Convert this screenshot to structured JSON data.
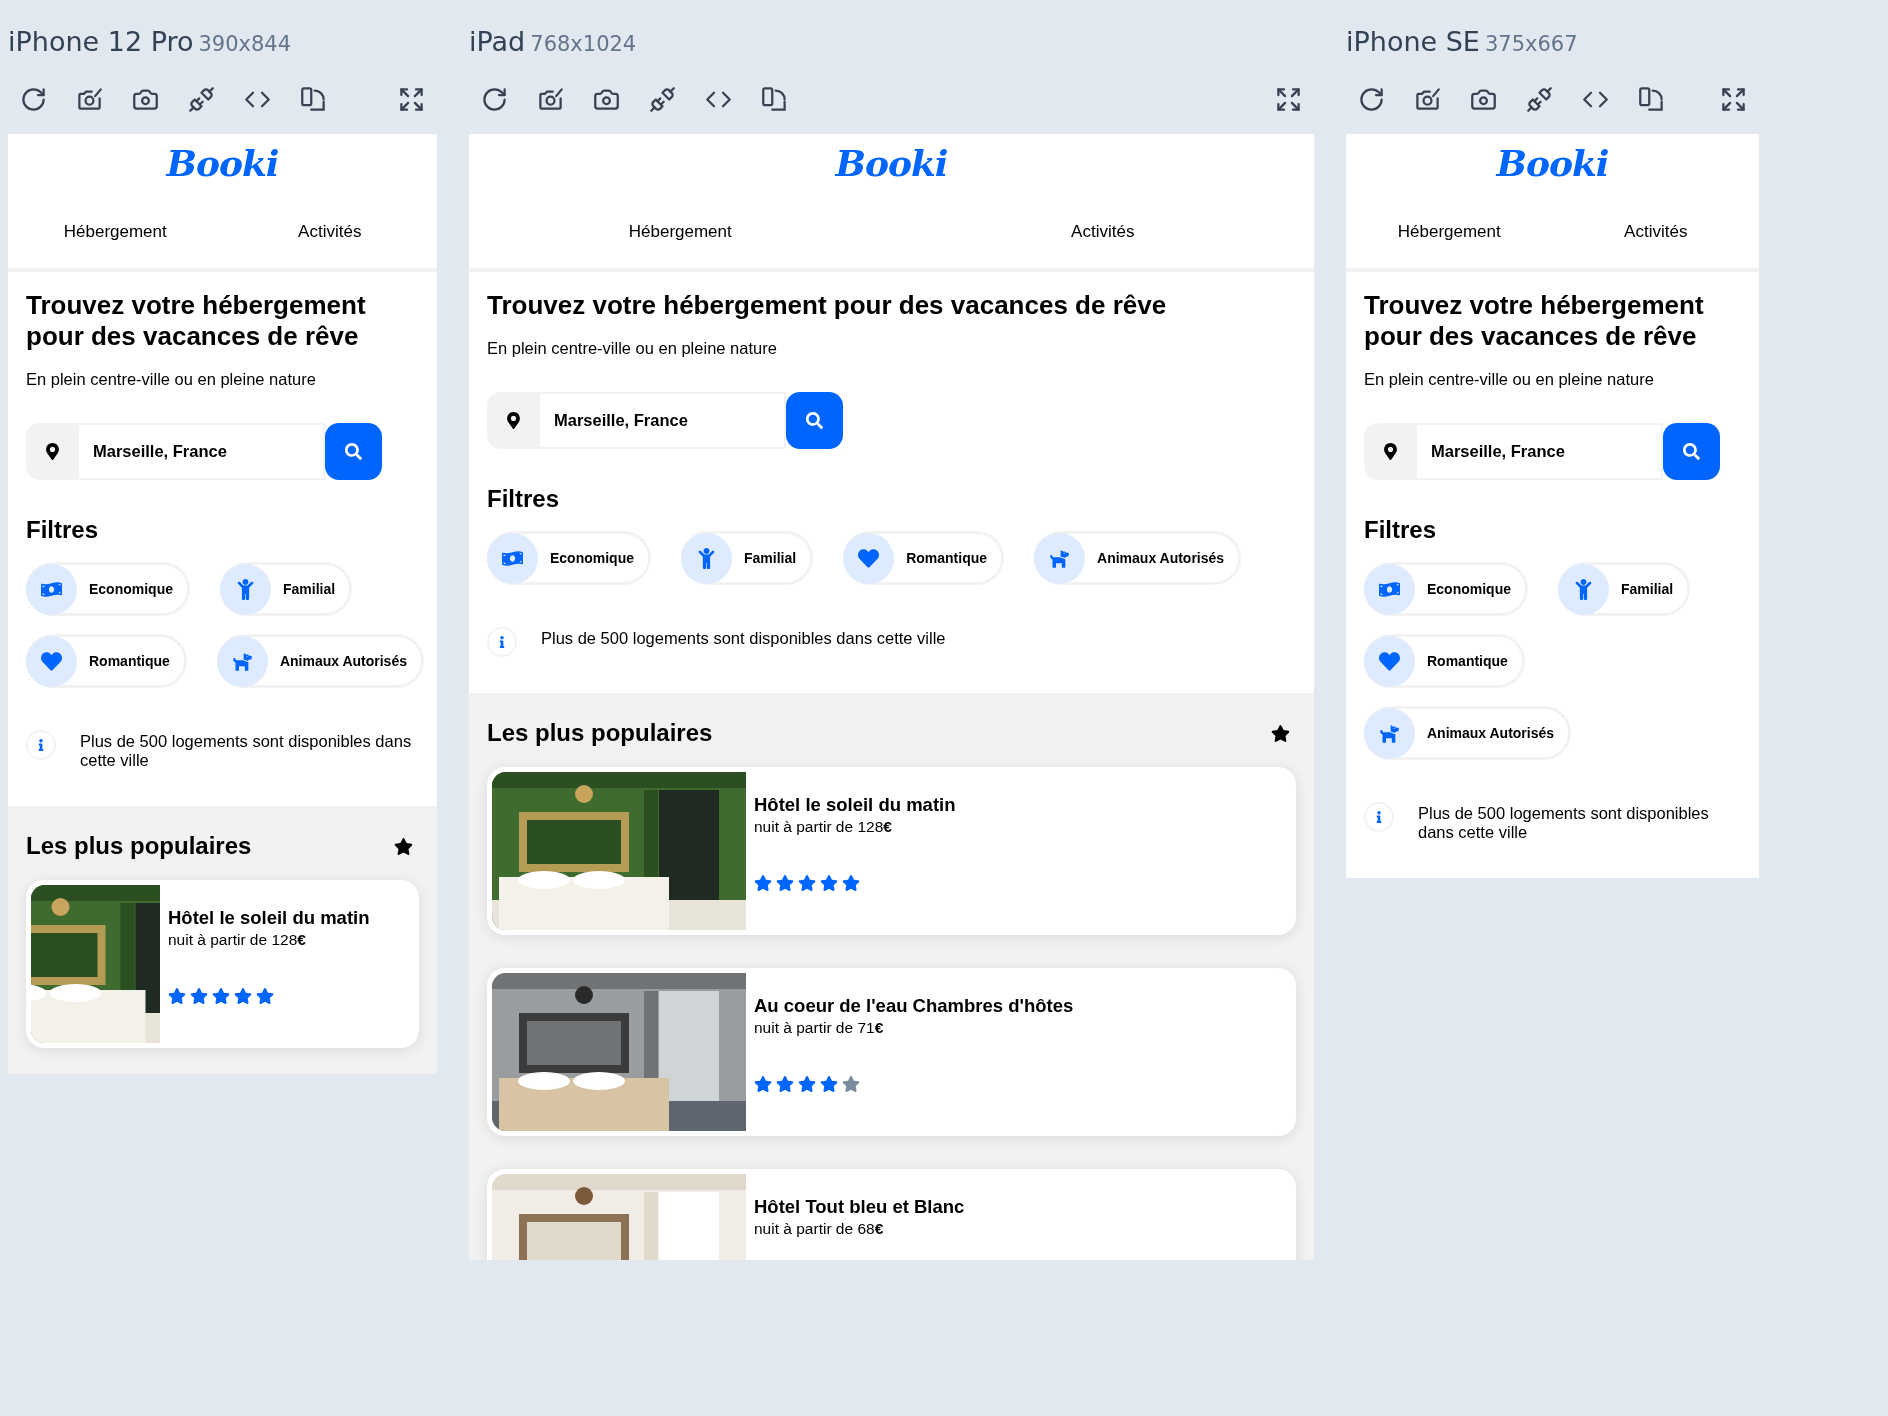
{
  "devices": [
    {
      "name": "iPhone 12 Pro",
      "size": "390x844",
      "site": {
        "logo": "Booki",
        "nav": [
          {
            "label": "Hébergement"
          },
          {
            "label": "Activités"
          }
        ],
        "title": "Trouvez votre hébergement pour des vacances de rêve",
        "subtitle": "En plein centre-ville ou en pleine nature",
        "search": {
          "value": "Marseille, France"
        },
        "filters_title": "Filtres",
        "filters": [
          {
            "label": "Economique"
          },
          {
            "label": "Familial"
          },
          {
            "label": "Romantique"
          },
          {
            "label": "Animaux Autorisés"
          }
        ],
        "info": "Plus de 500 logements sont disponibles dans cette ville",
        "popular": {
          "title": "Les plus populaires",
          "hotels": [
            {
              "name": "Hôtel le soleil du matin",
              "price": "nuit à partir de 128**€**",
              "stars": 5
            }
          ]
        }
      }
    },
    {
      "name": "iPad",
      "size": "768x1024",
      "site": {
        "logo": "Booki",
        "nav": [
          {
            "label": "Hébergement"
          },
          {
            "label": "Activités"
          }
        ],
        "title": "Trouvez votre hébergement pour des vacances de rêve",
        "subtitle": "En plein centre-ville ou en pleine nature",
        "search": {
          "value": "Marseille, France"
        },
        "filters_title": "Filtres",
        "filters": [
          {
            "label": "Economique"
          },
          {
            "label": "Familial"
          },
          {
            "label": "Romantique"
          },
          {
            "label": "Animaux Autorisés"
          }
        ],
        "info": "Plus de 500 logements sont disponibles dans cette ville",
        "popular": {
          "title": "Les plus populaires",
          "hotels": [
            {
              "name": "Hôtel le soleil du matin",
              "price": "nuit à partir de 128**€**",
              "stars": 5
            },
            {
              "name": "Au coeur de l'eau Chambres d'hôtes",
              "price": "nuit à partir de 71**€**",
              "stars": 4
            },
            {
              "name": "Hôtel Tout bleu et Blanc",
              "price": "nuit à partir de 68**€**"
            }
          ]
        }
      }
    },
    {
      "name": "iPhone SE",
      "size": "375x667",
      "site": {
        "logo": "Booki",
        "nav": [
          {
            "label": "Hébergement"
          },
          {
            "label": "Activités"
          }
        ],
        "title": "Trouvez votre hébergement pour des vacances de rêve",
        "subtitle": "En plein centre-ville ou en pleine nature",
        "search": {
          "value": "Marseille, France"
        },
        "filters_title": "Filtres",
        "filters": [
          {
            "label": "Economique"
          },
          {
            "label": "Familial"
          },
          {
            "label": "Romantique"
          },
          {
            "label": "Animaux Autorisés"
          }
        ],
        "info": "Plus de 500 logements sont disponibles dans cette ville"
      }
    }
  ]
}
